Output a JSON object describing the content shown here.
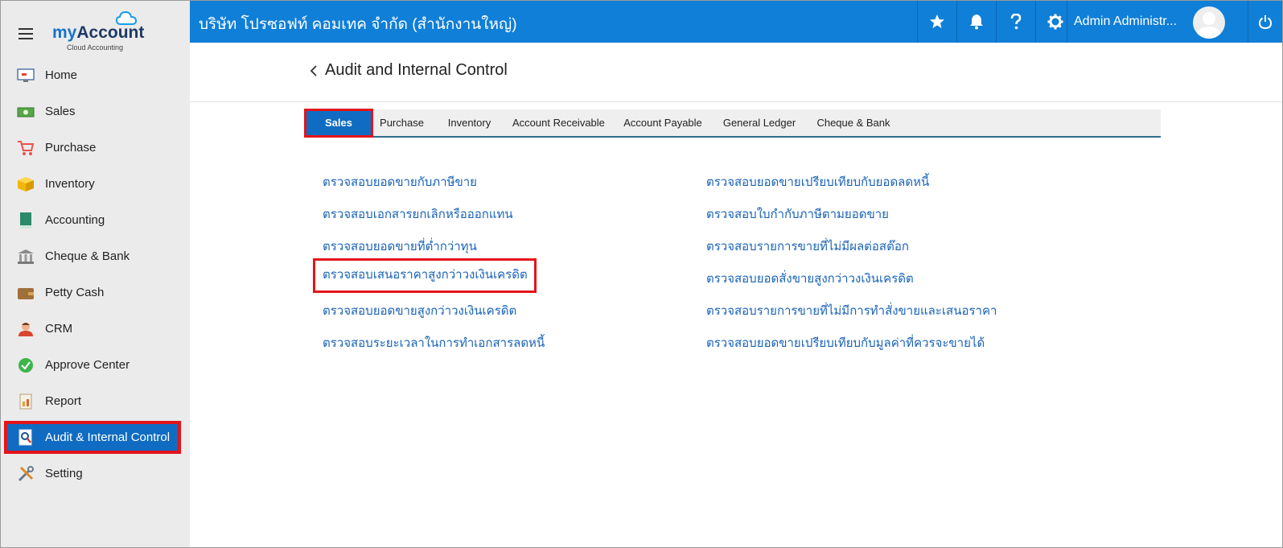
{
  "app": {
    "logo_my": "my",
    "logo_account": "Account",
    "logo_sub": "Cloud Accounting"
  },
  "sidebar": {
    "items": [
      {
        "label": "Home",
        "icon": "home-icon"
      },
      {
        "label": "Sales",
        "icon": "sales-icon"
      },
      {
        "label": "Purchase",
        "icon": "cart-icon"
      },
      {
        "label": "Inventory",
        "icon": "box-icon"
      },
      {
        "label": "Accounting",
        "icon": "book-icon"
      },
      {
        "label": "Cheque & Bank",
        "icon": "bank-icon"
      },
      {
        "label": "Petty Cash",
        "icon": "wallet-icon"
      },
      {
        "label": "CRM",
        "icon": "crm-icon"
      },
      {
        "label": "Approve Center",
        "icon": "check-circle-icon"
      },
      {
        "label": "Report",
        "icon": "report-icon"
      },
      {
        "label": "Audit & Internal Control",
        "icon": "audit-icon",
        "active": true
      },
      {
        "label": "Setting",
        "icon": "tools-icon"
      }
    ]
  },
  "topbar": {
    "company": "บริษัท โปรซอฟท์ คอมเทค จำกัด (สำนักงานใหญ่)",
    "user_name": "Admin Administr...",
    "accent": "#0f7fd8"
  },
  "page": {
    "title": "Audit and Internal Control"
  },
  "tabs": [
    "Sales",
    "Purchase",
    "Inventory",
    "Account Receivable",
    "Account Payable",
    "General Ledger",
    "Cheque & Bank"
  ],
  "links_left": [
    "ตรวจสอบยอดขายกับภาษีขาย",
    "ตรวจสอบเอกสารยกเลิกหรือออกแทน",
    "ตรวจสอบยอดขายที่ต่ำกว่าทุน",
    "ตรวจสอบเสนอราคาสูงกว่าวงเงินเครดิต",
    "ตรวจสอบยอดขายสูงกว่าวงเงินเครดิต",
    "ตรวจสอบระยะเวลาในการทำเอกสารลดหนี้"
  ],
  "links_right": [
    "ตรวจสอบยอดขายเปรียบเทียบกับยอดลดหนี้",
    "ตรวจสอบใบกำกับภาษีตามยอดขาย",
    "ตรวจสอบรายการขายที่ไม่มีผลต่อสต๊อก",
    "ตรวจสอบยอดสั่งขายสูงกว่าวงเงินเครดิต",
    "ตรวจสอบรายการขายที่ไม่มีการทำสั่งขายและเสนอราคา",
    "ตรวจสอบยอดขายเปรียบเทียบกับมูลค่าที่ควรจะขายได้"
  ]
}
